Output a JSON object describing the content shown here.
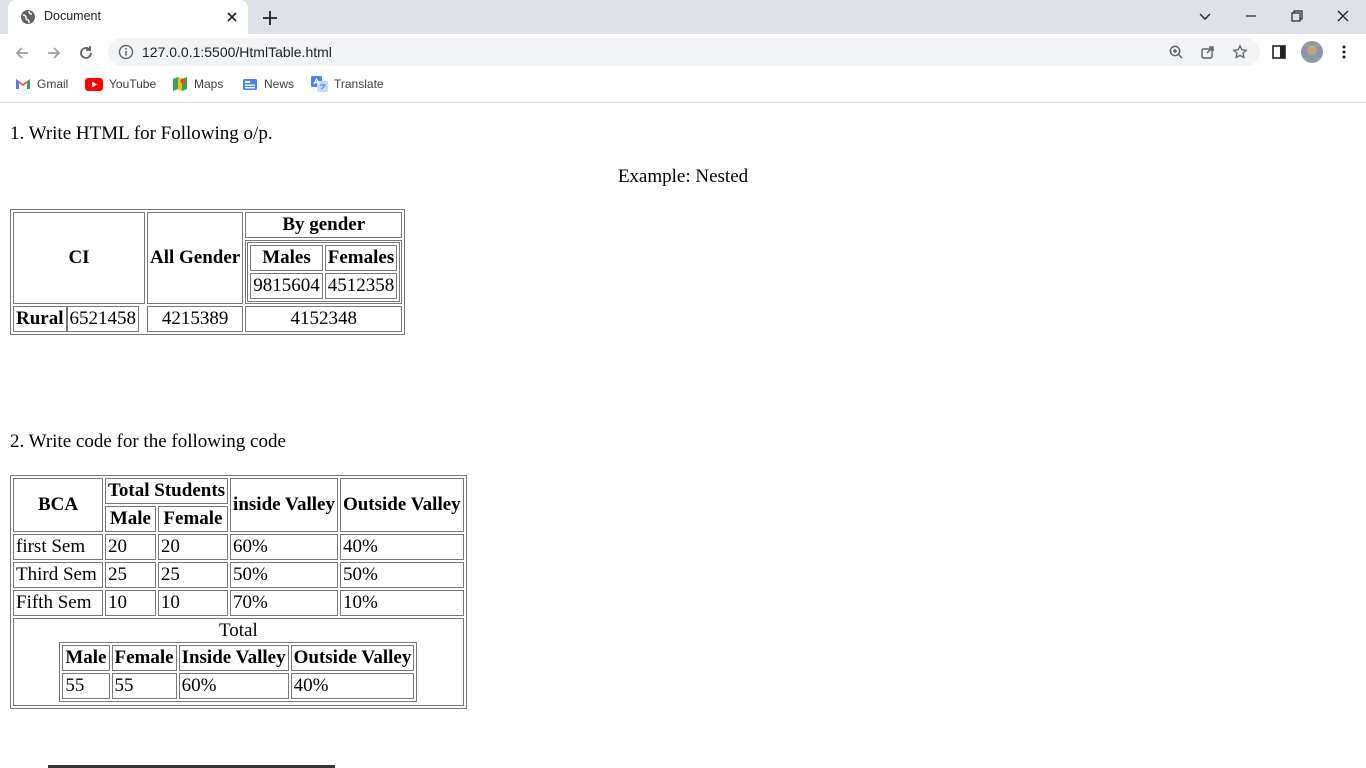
{
  "browser": {
    "tab_title": "Document",
    "url": "127.0.0.1:5500/HtmlTable.html",
    "bookmarks": [
      "Gmail",
      "YouTube",
      "Maps",
      "News",
      "Translate"
    ]
  },
  "page": {
    "q1": "1. Write HTML for Following o/p.",
    "example": "Example: Nested",
    "q2": "2. Write code for the following code"
  },
  "table1": {
    "h_ci": "CI",
    "h_all_gender": "All Gender",
    "h_by_gender": "By gender",
    "h_males": "Males",
    "h_females": "Females",
    "males": "9815604",
    "females": "4512358",
    "rural_label": "Rural",
    "rural_ci": "6521458",
    "rural_all": "4215389",
    "rural_by": "4152348"
  },
  "table2": {
    "h_bca": "BCA",
    "h_total_students": "Total Students",
    "h_male": "Male",
    "h_female": "Female",
    "h_inside": "inside Valley",
    "h_outside": "Outside Valley",
    "rows": [
      {
        "sem": "first Sem",
        "male": "20",
        "female": "20",
        "inside": "60%",
        "outside": "40%"
      },
      {
        "sem": "Third Sem",
        "male": "25",
        "female": "25",
        "inside": "50%",
        "outside": "50%"
      },
      {
        "sem": "Fifth Sem",
        "male": "10",
        "female": "10",
        "inside": "70%",
        "outside": "10%"
      }
    ],
    "total_label": "Total",
    "total": {
      "h_male": "Male",
      "h_female": "Female",
      "h_inside": "Inside Valley",
      "h_outside": "Outside Valley",
      "male": "55",
      "female": "55",
      "inside": "60%",
      "outside": "40%"
    }
  }
}
